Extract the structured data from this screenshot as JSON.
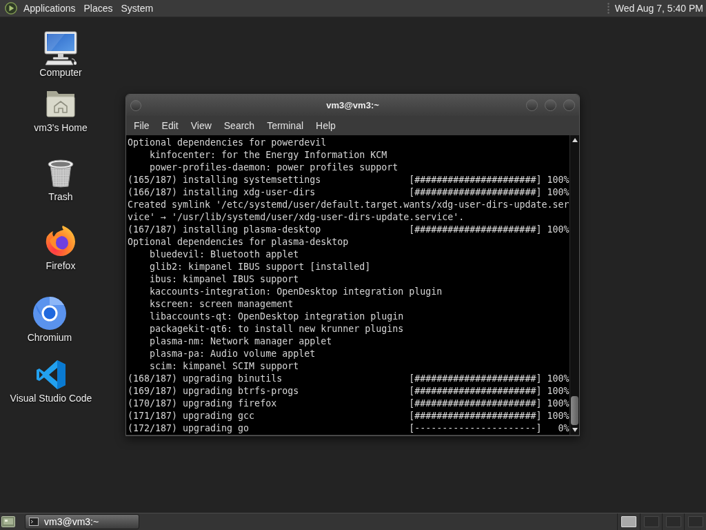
{
  "top_panel": {
    "menus": [
      "Applications",
      "Places",
      "System"
    ],
    "clock": "Wed Aug 7, 5:40 PM"
  },
  "desktop_icons": [
    {
      "kind": "computer",
      "label": "Computer"
    },
    {
      "kind": "home",
      "label": "vm3's Home"
    },
    {
      "kind": "trash",
      "label": "Trash"
    },
    {
      "kind": "firefox",
      "label": "Firefox"
    },
    {
      "kind": "chromium",
      "label": "Chromium"
    },
    {
      "kind": "vscode",
      "label": "Visual Studio Code"
    }
  ],
  "terminal": {
    "title": "vm3@vm3:~",
    "menus": [
      "File",
      "Edit",
      "View",
      "Search",
      "Terminal",
      "Help"
    ],
    "lines": [
      {
        "kind": "text",
        "text": "Optional dependencies for powerdevil",
        "children": [
          {
            "text": "kinfocenter: for the Energy Information KCM"
          },
          {
            "text": "power-profiles-daemon: power profiles support"
          }
        ]
      },
      {
        "kind": "progress",
        "label": "(165/187) installing systemsettings",
        "bar": "[######################]",
        "percent": "100%"
      },
      {
        "kind": "progress",
        "label": "(166/187) installing xdg-user-dirs",
        "bar": "[######################]",
        "percent": "100%"
      },
      {
        "kind": "text",
        "text": "Created symlink '/etc/systemd/user/default.target.wants/xdg-user-dirs-update.ser"
      },
      {
        "kind": "text",
        "text": "vice' → '/usr/lib/systemd/user/xdg-user-dirs-update.service'."
      },
      {
        "kind": "progress",
        "label": "(167/187) installing plasma-desktop",
        "bar": "[######################]",
        "percent": "100%"
      },
      {
        "kind": "text",
        "text": "Optional dependencies for plasma-desktop",
        "children": [
          {
            "text": "bluedevil: Bluetooth applet"
          },
          {
            "text": "glib2: kimpanel IBUS support [installed]"
          },
          {
            "text": "ibus: kimpanel IBUS support"
          },
          {
            "text": "kaccounts-integration: OpenDesktop integration plugin"
          },
          {
            "text": "kscreen: screen management"
          },
          {
            "text": "libaccounts-qt: OpenDesktop integration plugin"
          },
          {
            "text": "packagekit-qt6: to install new krunner plugins"
          },
          {
            "text": "plasma-nm: Network manager applet"
          },
          {
            "text": "plasma-pa: Audio volume applet"
          },
          {
            "text": "scim: kimpanel SCIM support"
          }
        ]
      },
      {
        "kind": "progress",
        "label": "(168/187) upgrading binutils",
        "bar": "[######################]",
        "percent": "100%"
      },
      {
        "kind": "progress",
        "label": "(169/187) upgrading btrfs-progs",
        "bar": "[######################]",
        "percent": "100%"
      },
      {
        "kind": "progress",
        "label": "(170/187) upgrading firefox",
        "bar": "[######################]",
        "percent": "100%"
      },
      {
        "kind": "progress",
        "label": "(171/187) upgrading gcc",
        "bar": "[######################]",
        "percent": "100%"
      },
      {
        "kind": "progress",
        "label": "(172/187) upgrading go",
        "bar": "[----------------------]",
        "percent": "0%"
      }
    ]
  },
  "bottom_panel": {
    "tasks": [
      {
        "label": "vm3@vm3:~",
        "selected": true
      }
    ],
    "workspaces": [
      {
        "selected": true
      },
      {
        "selected": false
      },
      {
        "selected": false
      },
      {
        "selected": false
      }
    ]
  }
}
